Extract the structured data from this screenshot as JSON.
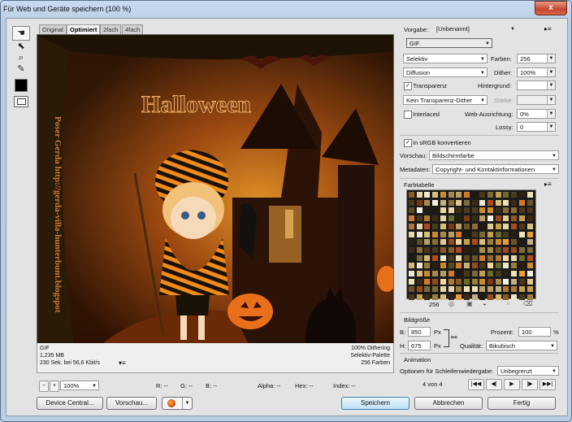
{
  "window": {
    "title": "Für Web und Geräte speichern (100 %)",
    "close_label": "x"
  },
  "tools": [
    {
      "name": "hand-tool",
      "glyph": "☚"
    },
    {
      "name": "slice-select-tool",
      "glyph": "⬉"
    },
    {
      "name": "zoom-tool",
      "glyph": "⌕"
    },
    {
      "name": "eyedropper-tool",
      "glyph": "✎"
    }
  ],
  "tabs": [
    "Original",
    "Optimiert",
    "2fach",
    "4fach"
  ],
  "active_tab": "Optimiert",
  "preview": {
    "title_text": "Halloween",
    "watermark": "Poser Gerda http://gerda-villa-hunterbunt.blogspot"
  },
  "info": {
    "format": "GIF",
    "size": "1,235 MB",
    "time": "230 Sek. bei 56,6 Kbit/s",
    "dithering": "100% Dithering",
    "palette": "Selektiv-Palette",
    "colors": "256 Farben"
  },
  "status": {
    "zoom": "100%",
    "r": "R: --",
    "g": "G: --",
    "b": "B: --",
    "alpha": "Alpha: --",
    "hex": "Hex: --",
    "index": "Index: --"
  },
  "buttons": {
    "device_central": "Device Central...",
    "preview": "Vorschau...",
    "save": "Speichern",
    "cancel": "Abbrechen",
    "done": "Fertig"
  },
  "settings": {
    "preset_label": "Vorgabe:",
    "preset_value": "[Unbenannt]",
    "format": "GIF",
    "reduction": "Selektiv",
    "colors_label": "Farben:",
    "colors_value": "256",
    "dither_method": "Diffusion",
    "dither_label": "Dither:",
    "dither_value": "100%",
    "transparency_label": "Transparenz",
    "transparency_checked": true,
    "matte_label": "Hintergrund:",
    "matte_value": "",
    "trans_dither": "Kein Transparenz-Dither",
    "amount_label": "Stärke:",
    "amount_value": "",
    "interlaced_label": "Interlaced",
    "interlaced_checked": false,
    "web_snap_label": "Web-Ausrichtung:",
    "web_snap_value": "0%",
    "lossy_label": "Lossy:",
    "lossy_value": "0",
    "srgb_label": "In sRGB konvertieren",
    "srgb_checked": true,
    "preview_label": "Vorschau:",
    "preview_value": "Bildschirmfarbe",
    "metadata_label": "Metadaten:",
    "metadata_value": "Copyright- und Kontaktinformationen"
  },
  "color_table": {
    "title": "Farbtabelle",
    "count": "256",
    "colors": [
      "#8b5a1e",
      "#c2a14a",
      "#3d2a12",
      "#e6d7a8",
      "#6b6b2a",
      "#b04a1c",
      "#f0e8d0",
      "#4a3b1c",
      "#9c7d3a",
      "#d9c07a",
      "#2b1f10",
      "#7a3a14",
      "#c98b2e",
      "#efe2b6",
      "#5a4a22",
      "#a88a4a",
      "#e8a030",
      "#3a2c16",
      "#b8a060",
      "#f6f0e0",
      "#6c5428",
      "#d47a2a",
      "#8c6c30",
      "#c4b080",
      "#1e1a12",
      "#9a4a1a",
      "#e2c890",
      "#4c3818",
      "#b07a34",
      "#f2d6a0",
      "#7a6a3a",
      "#d8b870"
    ]
  },
  "image_size": {
    "title": "Bildgröße",
    "w_label": "B:",
    "w_value": "850",
    "w_unit": "Px",
    "h_label": "H:",
    "h_value": "675",
    "h_unit": "Px",
    "percent_label": "Prozent:",
    "percent_value": "100",
    "percent_unit": "%",
    "quality_label": "Qualität:",
    "quality_value": "Bikubisch"
  },
  "animation": {
    "title": "Animation",
    "loop_label": "Optionen für Schleifenwiedergabe:",
    "loop_value": "Unbegrenzt",
    "frame": "4 von 4"
  }
}
